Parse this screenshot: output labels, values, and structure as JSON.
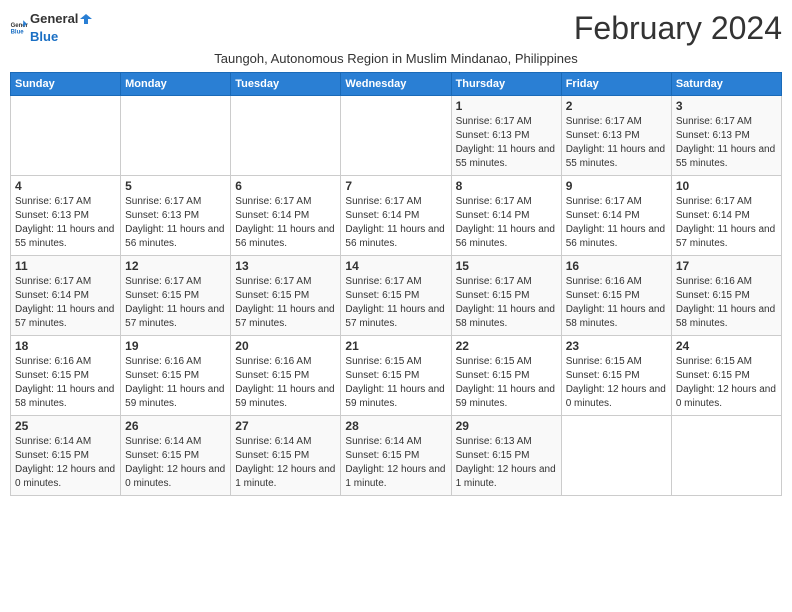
{
  "logo": {
    "text_general": "General",
    "text_blue": "Blue"
  },
  "header": {
    "month_year": "February 2024",
    "subtitle": "Taungoh, Autonomous Region in Muslim Mindanao, Philippines"
  },
  "weekdays": [
    "Sunday",
    "Monday",
    "Tuesday",
    "Wednesday",
    "Thursday",
    "Friday",
    "Saturday"
  ],
  "weeks": [
    [
      {
        "day": "",
        "info": ""
      },
      {
        "day": "",
        "info": ""
      },
      {
        "day": "",
        "info": ""
      },
      {
        "day": "",
        "info": ""
      },
      {
        "day": "1",
        "info": "Sunrise: 6:17 AM\nSunset: 6:13 PM\nDaylight: 11 hours and 55 minutes."
      },
      {
        "day": "2",
        "info": "Sunrise: 6:17 AM\nSunset: 6:13 PM\nDaylight: 11 hours and 55 minutes."
      },
      {
        "day": "3",
        "info": "Sunrise: 6:17 AM\nSunset: 6:13 PM\nDaylight: 11 hours and 55 minutes."
      }
    ],
    [
      {
        "day": "4",
        "info": "Sunrise: 6:17 AM\nSunset: 6:13 PM\nDaylight: 11 hours and 55 minutes."
      },
      {
        "day": "5",
        "info": "Sunrise: 6:17 AM\nSunset: 6:13 PM\nDaylight: 11 hours and 56 minutes."
      },
      {
        "day": "6",
        "info": "Sunrise: 6:17 AM\nSunset: 6:14 PM\nDaylight: 11 hours and 56 minutes."
      },
      {
        "day": "7",
        "info": "Sunrise: 6:17 AM\nSunset: 6:14 PM\nDaylight: 11 hours and 56 minutes."
      },
      {
        "day": "8",
        "info": "Sunrise: 6:17 AM\nSunset: 6:14 PM\nDaylight: 11 hours and 56 minutes."
      },
      {
        "day": "9",
        "info": "Sunrise: 6:17 AM\nSunset: 6:14 PM\nDaylight: 11 hours and 56 minutes."
      },
      {
        "day": "10",
        "info": "Sunrise: 6:17 AM\nSunset: 6:14 PM\nDaylight: 11 hours and 57 minutes."
      }
    ],
    [
      {
        "day": "11",
        "info": "Sunrise: 6:17 AM\nSunset: 6:14 PM\nDaylight: 11 hours and 57 minutes."
      },
      {
        "day": "12",
        "info": "Sunrise: 6:17 AM\nSunset: 6:15 PM\nDaylight: 11 hours and 57 minutes."
      },
      {
        "day": "13",
        "info": "Sunrise: 6:17 AM\nSunset: 6:15 PM\nDaylight: 11 hours and 57 minutes."
      },
      {
        "day": "14",
        "info": "Sunrise: 6:17 AM\nSunset: 6:15 PM\nDaylight: 11 hours and 57 minutes."
      },
      {
        "day": "15",
        "info": "Sunrise: 6:17 AM\nSunset: 6:15 PM\nDaylight: 11 hours and 58 minutes."
      },
      {
        "day": "16",
        "info": "Sunrise: 6:16 AM\nSunset: 6:15 PM\nDaylight: 11 hours and 58 minutes."
      },
      {
        "day": "17",
        "info": "Sunrise: 6:16 AM\nSunset: 6:15 PM\nDaylight: 11 hours and 58 minutes."
      }
    ],
    [
      {
        "day": "18",
        "info": "Sunrise: 6:16 AM\nSunset: 6:15 PM\nDaylight: 11 hours and 58 minutes."
      },
      {
        "day": "19",
        "info": "Sunrise: 6:16 AM\nSunset: 6:15 PM\nDaylight: 11 hours and 59 minutes."
      },
      {
        "day": "20",
        "info": "Sunrise: 6:16 AM\nSunset: 6:15 PM\nDaylight: 11 hours and 59 minutes."
      },
      {
        "day": "21",
        "info": "Sunrise: 6:15 AM\nSunset: 6:15 PM\nDaylight: 11 hours and 59 minutes."
      },
      {
        "day": "22",
        "info": "Sunrise: 6:15 AM\nSunset: 6:15 PM\nDaylight: 11 hours and 59 minutes."
      },
      {
        "day": "23",
        "info": "Sunrise: 6:15 AM\nSunset: 6:15 PM\nDaylight: 12 hours and 0 minutes."
      },
      {
        "day": "24",
        "info": "Sunrise: 6:15 AM\nSunset: 6:15 PM\nDaylight: 12 hours and 0 minutes."
      }
    ],
    [
      {
        "day": "25",
        "info": "Sunrise: 6:14 AM\nSunset: 6:15 PM\nDaylight: 12 hours and 0 minutes."
      },
      {
        "day": "26",
        "info": "Sunrise: 6:14 AM\nSunset: 6:15 PM\nDaylight: 12 hours and 0 minutes."
      },
      {
        "day": "27",
        "info": "Sunrise: 6:14 AM\nSunset: 6:15 PM\nDaylight: 12 hours and 1 minute."
      },
      {
        "day": "28",
        "info": "Sunrise: 6:14 AM\nSunset: 6:15 PM\nDaylight: 12 hours and 1 minute."
      },
      {
        "day": "29",
        "info": "Sunrise: 6:13 AM\nSunset: 6:15 PM\nDaylight: 12 hours and 1 minute."
      },
      {
        "day": "",
        "info": ""
      },
      {
        "day": "",
        "info": ""
      }
    ]
  ]
}
